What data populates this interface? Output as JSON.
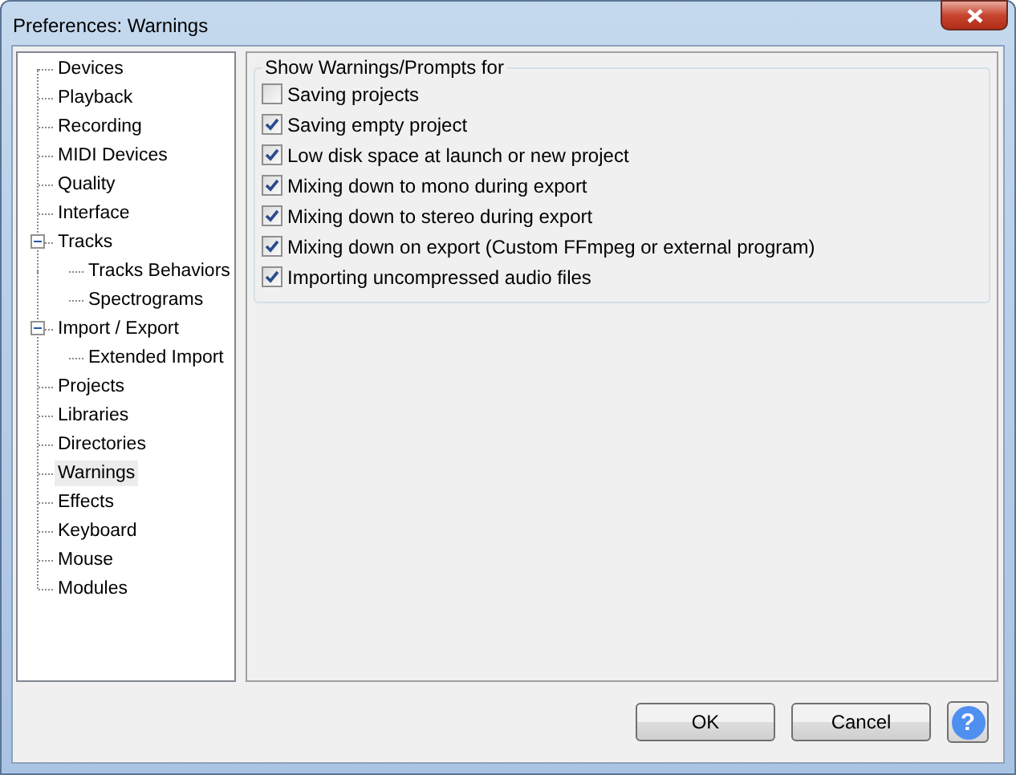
{
  "window": {
    "title": "Preferences: Warnings"
  },
  "tree": [
    {
      "label": "Devices",
      "selected": false
    },
    {
      "label": "Playback",
      "selected": false
    },
    {
      "label": "Recording",
      "selected": false
    },
    {
      "label": "MIDI Devices",
      "selected": false
    },
    {
      "label": "Quality",
      "selected": false
    },
    {
      "label": "Interface",
      "selected": false
    },
    {
      "label": "Tracks",
      "selected": false,
      "expanded": true,
      "children": [
        {
          "label": "Tracks Behaviors",
          "selected": false
        },
        {
          "label": "Spectrograms",
          "selected": false
        }
      ]
    },
    {
      "label": "Import / Export",
      "selected": false,
      "expanded": true,
      "children": [
        {
          "label": "Extended Import",
          "selected": false
        }
      ]
    },
    {
      "label": "Projects",
      "selected": false
    },
    {
      "label": "Libraries",
      "selected": false
    },
    {
      "label": "Directories",
      "selected": false
    },
    {
      "label": "Warnings",
      "selected": true
    },
    {
      "label": "Effects",
      "selected": false
    },
    {
      "label": "Keyboard",
      "selected": false
    },
    {
      "label": "Mouse",
      "selected": false
    },
    {
      "label": "Modules",
      "selected": false
    }
  ],
  "group": {
    "title": "Show Warnings/Prompts for",
    "options": [
      {
        "label": "Saving projects",
        "checked": false
      },
      {
        "label": "Saving empty project",
        "checked": true
      },
      {
        "label": "Low disk space at launch or new project",
        "checked": true
      },
      {
        "label": "Mixing down to mono during export",
        "checked": true
      },
      {
        "label": "Mixing down to stereo during export",
        "checked": true
      },
      {
        "label": "Mixing down on export (Custom FFmpeg or external program)",
        "checked": true
      },
      {
        "label": "Importing uncompressed audio files",
        "checked": true
      }
    ]
  },
  "buttons": [
    "OK",
    "Cancel"
  ],
  "help": "?"
}
